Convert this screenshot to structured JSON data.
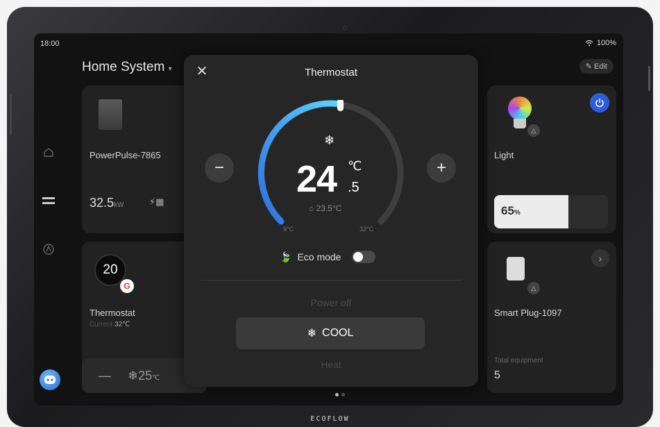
{
  "status": {
    "time": "18:00",
    "battery": "100%"
  },
  "header": {
    "title": "Home System",
    "edit_label": "Edit"
  },
  "devices": {
    "powerpulse": {
      "name": "PowerPulse-7865",
      "power": "32.5",
      "unit": "kW"
    },
    "thermostat": {
      "name": "Thermostat",
      "current_label": "Current",
      "current_value": "32℃",
      "setpoint": "20",
      "mini_set": "25",
      "mini_unit": "℃"
    },
    "light": {
      "name": "Light",
      "brightness": "65",
      "brightness_unit": "%",
      "brightness_fraction": 0.65
    },
    "plug": {
      "name": "Smart Plug-1097",
      "total_label": "Total equipment",
      "total_value": "5"
    }
  },
  "modal": {
    "title": "Thermostat",
    "temp_int": "24",
    "temp_dec": ".5",
    "temp_unit": "℃",
    "home_temp": "23.5°C",
    "min_label": "9°C",
    "max_label": "32°C",
    "eco_label": "Eco mode",
    "eco_on": false,
    "options": {
      "power_off": "Power off",
      "cool": "COOL",
      "heat": "Heat"
    },
    "selected_option": "COOL"
  },
  "brand": "ECOFLOW",
  "colors": {
    "accent": "#2f5fd8",
    "dial_start": "#2f6fe0",
    "dial_end": "#5ad4ff"
  }
}
